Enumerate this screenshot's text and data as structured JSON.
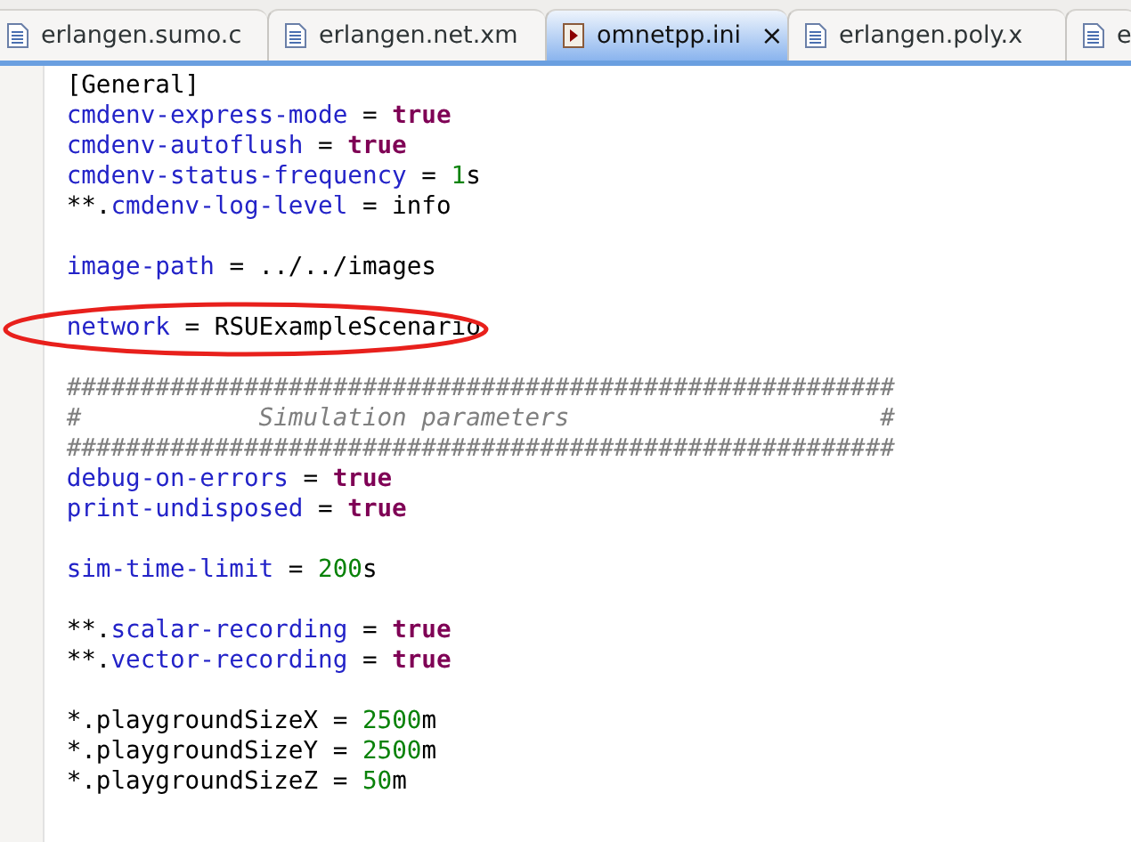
{
  "tabs": [
    {
      "label": "erlangen.sumo.c",
      "kind": "document",
      "selected": false
    },
    {
      "label": "erlangen.net.xm",
      "kind": "document",
      "selected": false
    },
    {
      "label": "omnetpp.ini",
      "kind": "ini",
      "selected": true,
      "close": "×"
    },
    {
      "label": "erlangen.poly.x",
      "kind": "document",
      "selected": false
    },
    {
      "label": "e",
      "kind": "document",
      "selected": false
    }
  ],
  "editor": {
    "lines": [
      {
        "kind": "code",
        "tokens": [
          {
            "kind": "plain",
            "text": "[General]"
          }
        ]
      },
      {
        "kind": "code",
        "tokens": [
          {
            "kind": "key",
            "text": "cmdenv-express-mode"
          },
          {
            "kind": "plain",
            "text": " = "
          },
          {
            "kind": "bool",
            "text": "true"
          }
        ]
      },
      {
        "kind": "code",
        "tokens": [
          {
            "kind": "key",
            "text": "cmdenv-autoflush"
          },
          {
            "kind": "plain",
            "text": " = "
          },
          {
            "kind": "bool",
            "text": "true"
          }
        ]
      },
      {
        "kind": "code",
        "tokens": [
          {
            "kind": "key",
            "text": "cmdenv-status-frequency"
          },
          {
            "kind": "plain",
            "text": " = "
          },
          {
            "kind": "num",
            "text": "1"
          },
          {
            "kind": "plain",
            "text": "s"
          }
        ]
      },
      {
        "kind": "code",
        "tokens": [
          {
            "kind": "plain",
            "text": "**."
          },
          {
            "kind": "key",
            "text": "cmdenv-log-level"
          },
          {
            "kind": "plain",
            "text": " = info"
          }
        ]
      },
      {
        "kind": "blank"
      },
      {
        "kind": "code",
        "tokens": [
          {
            "kind": "key",
            "text": "image-path"
          },
          {
            "kind": "plain",
            "text": " = ../../images"
          }
        ]
      },
      {
        "kind": "blank"
      },
      {
        "kind": "code",
        "circled": true,
        "tokens": [
          {
            "kind": "key",
            "text": "network"
          },
          {
            "kind": "plain",
            "text": " = RSUExampleScenario"
          }
        ]
      },
      {
        "kind": "blank"
      },
      {
        "kind": "code",
        "tokens": [
          {
            "kind": "comment",
            "text": "########################################################"
          }
        ]
      },
      {
        "kind": "code",
        "tokens": [
          {
            "kind": "comment",
            "text": "#            Simulation parameters                     #"
          }
        ]
      },
      {
        "kind": "code",
        "tokens": [
          {
            "kind": "comment",
            "text": "########################################################"
          }
        ]
      },
      {
        "kind": "code",
        "tokens": [
          {
            "kind": "key",
            "text": "debug-on-errors"
          },
          {
            "kind": "plain",
            "text": " = "
          },
          {
            "kind": "bool",
            "text": "true"
          }
        ]
      },
      {
        "kind": "code",
        "tokens": [
          {
            "kind": "key",
            "text": "print-undisposed"
          },
          {
            "kind": "plain",
            "text": " = "
          },
          {
            "kind": "bool",
            "text": "true"
          }
        ]
      },
      {
        "kind": "blank"
      },
      {
        "kind": "code",
        "tokens": [
          {
            "kind": "key",
            "text": "sim-time-limit"
          },
          {
            "kind": "plain",
            "text": " = "
          },
          {
            "kind": "num",
            "text": "200"
          },
          {
            "kind": "plain",
            "text": "s"
          }
        ]
      },
      {
        "kind": "blank"
      },
      {
        "kind": "code",
        "tokens": [
          {
            "kind": "plain",
            "text": "**."
          },
          {
            "kind": "key",
            "text": "scalar-recording"
          },
          {
            "kind": "plain",
            "text": " = "
          },
          {
            "kind": "bool",
            "text": "true"
          }
        ]
      },
      {
        "kind": "code",
        "tokens": [
          {
            "kind": "plain",
            "text": "**."
          },
          {
            "kind": "key",
            "text": "vector-recording"
          },
          {
            "kind": "plain",
            "text": " = "
          },
          {
            "kind": "bool",
            "text": "true"
          }
        ]
      },
      {
        "kind": "blank"
      },
      {
        "kind": "code",
        "tokens": [
          {
            "kind": "plain",
            "text": "*.playgroundSizeX = "
          },
          {
            "kind": "num",
            "text": "2500"
          },
          {
            "kind": "plain",
            "text": "m"
          }
        ]
      },
      {
        "kind": "code",
        "tokens": [
          {
            "kind": "plain",
            "text": "*.playgroundSizeY = "
          },
          {
            "kind": "num",
            "text": "2500"
          },
          {
            "kind": "plain",
            "text": "m"
          }
        ]
      },
      {
        "kind": "code",
        "tokens": [
          {
            "kind": "plain",
            "text": "*.playgroundSizeZ = "
          },
          {
            "kind": "num",
            "text": "50"
          },
          {
            "kind": "plain",
            "text": "m"
          }
        ]
      }
    ]
  }
}
